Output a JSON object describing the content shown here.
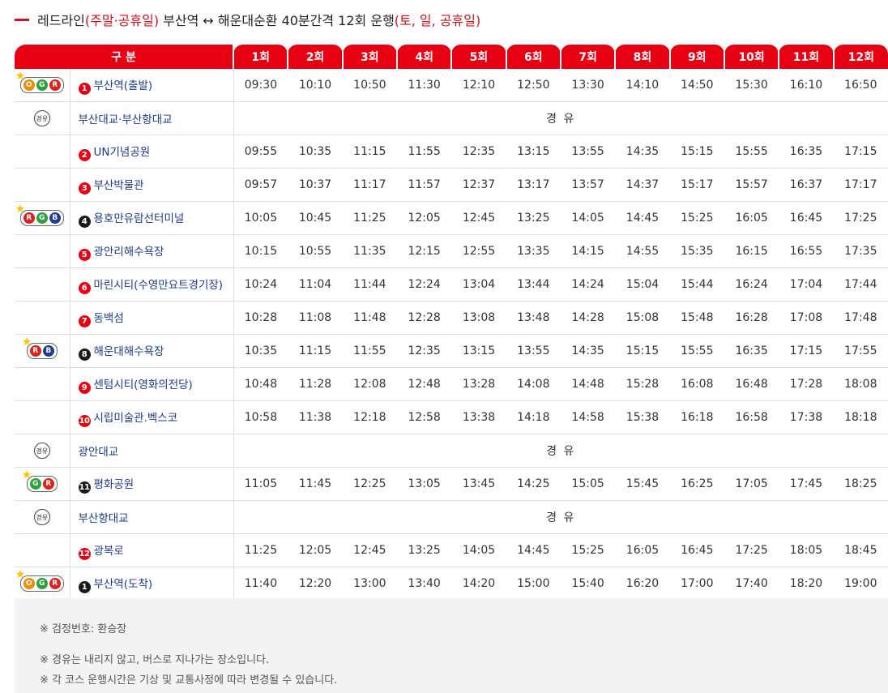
{
  "title": {
    "prefix": "레드라인",
    "highlight1": "(주말·공휴일)",
    "middle": " 부산역 ↔ 해운대순환 40분간격 12회 운행",
    "highlight2": "(토, 일, 공휴일)"
  },
  "colors": {
    "accent": "#e60012",
    "stop_text": "#1b3b8a",
    "orange": "#f08c00",
    "green": "#2aa33c",
    "red": "#e0201a",
    "blue": "#1f3d98",
    "star": "#f7c600"
  },
  "header": {
    "division": "구 분",
    "trips": [
      "1회",
      "2회",
      "3회",
      "4회",
      "5회",
      "6회",
      "7회",
      "8회",
      "9회",
      "10회",
      "11회",
      "12회"
    ]
  },
  "via_badge": "경유",
  "via_text": "경 유",
  "rows": [
    {
      "kind": "stop",
      "num": "1",
      "num_style": "red",
      "name": "부산역(출발)",
      "transfer": [
        "O",
        "G",
        "R"
      ],
      "times": [
        "09:30",
        "10:10",
        "10:50",
        "11:30",
        "12:10",
        "12:50",
        "13:30",
        "14:10",
        "14:50",
        "15:30",
        "16:10",
        "16:50"
      ]
    },
    {
      "kind": "via",
      "name": "부산대교·부산항대교"
    },
    {
      "kind": "stop",
      "num": "2",
      "num_style": "red",
      "name": "UN기념공원",
      "transfer": [],
      "times": [
        "09:55",
        "10:35",
        "11:15",
        "11:55",
        "12:35",
        "13:15",
        "13:55",
        "14:35",
        "15:15",
        "15:55",
        "16:35",
        "17:15"
      ]
    },
    {
      "kind": "stop",
      "num": "3",
      "num_style": "red",
      "name": "부산박물관",
      "transfer": [],
      "times": [
        "09:57",
        "10:37",
        "11:17",
        "11:57",
        "12:37",
        "13:17",
        "13:57",
        "14:37",
        "15:17",
        "15:57",
        "16:37",
        "17:17"
      ]
    },
    {
      "kind": "stop",
      "num": "4",
      "num_style": "black",
      "name": "용호만유람선터미널",
      "transfer": [
        "R",
        "G",
        "B"
      ],
      "times": [
        "10:05",
        "10:45",
        "11:25",
        "12:05",
        "12:45",
        "13:25",
        "14:05",
        "14:45",
        "15:25",
        "16:05",
        "16:45",
        "17:25"
      ]
    },
    {
      "kind": "stop",
      "num": "5",
      "num_style": "red",
      "name": "광안리해수욕장",
      "transfer": [],
      "times": [
        "10:15",
        "10:55",
        "11:35",
        "12:15",
        "12:55",
        "13:35",
        "14:15",
        "14:55",
        "15:35",
        "16:15",
        "16:55",
        "17:35"
      ]
    },
    {
      "kind": "stop",
      "num": "6",
      "num_style": "red",
      "name": "마린시티(수영만요트경기장)",
      "transfer": [],
      "times": [
        "10:24",
        "11:04",
        "11:44",
        "12:24",
        "13:04",
        "13:44",
        "14:24",
        "15:04",
        "15:44",
        "16:24",
        "17:04",
        "17:44"
      ]
    },
    {
      "kind": "stop",
      "num": "7",
      "num_style": "red",
      "name": "동백섬",
      "transfer": [],
      "times": [
        "10:28",
        "11:08",
        "11:48",
        "12:28",
        "13:08",
        "13:48",
        "14:28",
        "15:08",
        "15:48",
        "16:28",
        "17:08",
        "17:48"
      ]
    },
    {
      "kind": "stop",
      "num": "8",
      "num_style": "black",
      "name": "해운대해수욕장",
      "transfer": [
        "R",
        "B"
      ],
      "times": [
        "10:35",
        "11:15",
        "11:55",
        "12:35",
        "13:15",
        "13:55",
        "14:35",
        "15:15",
        "15:55",
        "16:35",
        "17:15",
        "17:55"
      ]
    },
    {
      "kind": "stop",
      "num": "9",
      "num_style": "red",
      "name": "센텀시티(영화의전당)",
      "transfer": [],
      "times": [
        "10:48",
        "11:28",
        "12:08",
        "12:48",
        "13:28",
        "14:08",
        "14:48",
        "15:28",
        "16:08",
        "16:48",
        "17:28",
        "18:08"
      ]
    },
    {
      "kind": "stop",
      "num": "10",
      "num_style": "red",
      "name": "시립미술관.벡스코",
      "transfer": [],
      "times": [
        "10:58",
        "11:38",
        "12:18",
        "12:58",
        "13:38",
        "14:18",
        "14:58",
        "15:38",
        "16:18",
        "16:58",
        "17:38",
        "18:18"
      ]
    },
    {
      "kind": "via",
      "name": "광안대교"
    },
    {
      "kind": "stop",
      "num": "11",
      "num_style": "black",
      "name": "평화공원",
      "transfer": [
        "G",
        "R"
      ],
      "times": [
        "11:05",
        "11:45",
        "12:25",
        "13:05",
        "13:45",
        "14:25",
        "15:05",
        "15:45",
        "16:25",
        "17:05",
        "17:45",
        "18:25"
      ]
    },
    {
      "kind": "via",
      "name": "부산항대교"
    },
    {
      "kind": "stop",
      "num": "12",
      "num_style": "red",
      "name": "광복로",
      "transfer": [],
      "times": [
        "11:25",
        "12:05",
        "12:45",
        "13:25",
        "14:05",
        "14:45",
        "15:25",
        "16:05",
        "16:45",
        "17:25",
        "18:05",
        "18:45"
      ]
    },
    {
      "kind": "stop",
      "num": "1",
      "num_style": "black",
      "name": "부산역(도착)",
      "transfer": [
        "O",
        "G",
        "R"
      ],
      "times": [
        "11:40",
        "12:20",
        "13:00",
        "13:40",
        "14:20",
        "15:00",
        "15:40",
        "16:20",
        "17:00",
        "17:40",
        "18:20",
        "19:00"
      ]
    }
  ],
  "notes": [
    "※ 검정번호: 환승장",
    "※ 경유는 내리지 않고, 버스로 지나가는 장소입니다.",
    "※ 각 코스 운행시간은 기상 및 교통사정에 따라 변경될 수 있습니다."
  ]
}
